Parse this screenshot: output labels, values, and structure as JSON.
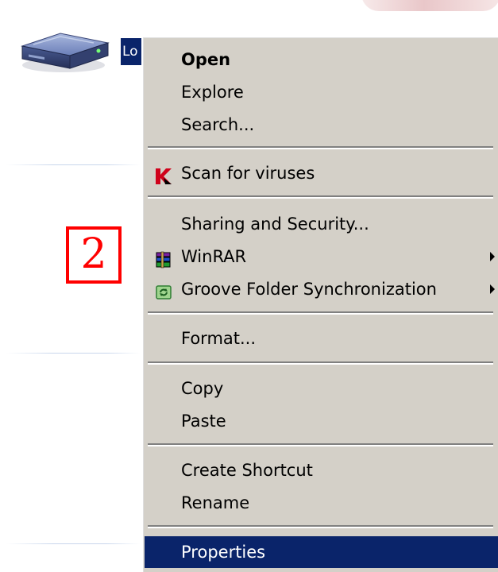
{
  "desktop": {
    "drive_label": "Lo",
    "step_number": "2"
  },
  "context_menu": {
    "items": [
      {
        "label": "Open",
        "bold": true
      },
      {
        "label": "Explore"
      },
      {
        "label": "Search..."
      },
      {
        "label": "Scan for viruses",
        "icon": "kaspersky-k-icon"
      },
      {
        "label": "Sharing and Security..."
      },
      {
        "label": "WinRAR",
        "icon": "winrar-books-icon",
        "submenu": true
      },
      {
        "label": "Groove Folder Synchronization",
        "icon": "groove-sync-icon",
        "submenu": true
      },
      {
        "label": "Format..."
      },
      {
        "label": "Copy"
      },
      {
        "label": "Paste"
      },
      {
        "label": "Create Shortcut"
      },
      {
        "label": "Rename"
      },
      {
        "label": "Properties",
        "highlighted": true
      }
    ]
  },
  "colors": {
    "menu_background": "#d4d0c8",
    "highlight": "#0a246a",
    "badge_red": "#ff0000"
  }
}
